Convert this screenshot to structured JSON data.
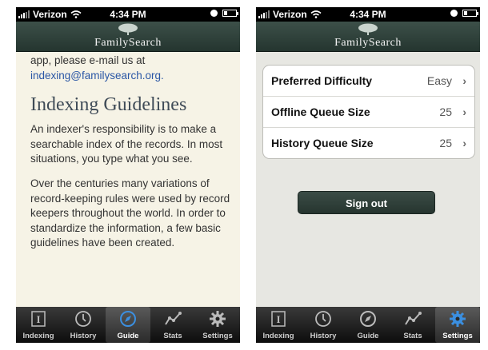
{
  "status": {
    "carrier": "Verizon",
    "time": "4:34 PM"
  },
  "brand": "FamilySearch",
  "guide": {
    "intro_text": "app, please e-mail us at",
    "email": "indexing@familysearch.org.",
    "heading": "Indexing Guidelines",
    "para1": "An indexer's responsibility is to make a searchable index of the records. In most situations, you type what you see.",
    "para2": "Over the centuries many variations of record-keeping rules were used by record keepers throughout the world. In order to standardize the information, a few basic guidelines have been created."
  },
  "settings": {
    "rows": [
      {
        "label": "Preferred Difficulty",
        "value": "Easy"
      },
      {
        "label": "Offline Queue Size",
        "value": "25"
      },
      {
        "label": "History Queue Size",
        "value": "25"
      }
    ],
    "signout_label": "Sign out"
  },
  "tabs": [
    {
      "label": "Indexing",
      "icon": "indexing-icon"
    },
    {
      "label": "History",
      "icon": "clock-icon"
    },
    {
      "label": "Guide",
      "icon": "compass-icon"
    },
    {
      "label": "Stats",
      "icon": "chart-icon"
    },
    {
      "label": "Settings",
      "icon": "gear-icon"
    }
  ],
  "colors": {
    "header": "#2f413a",
    "guide_bg": "#f6f3e6",
    "settings_bg": "#e7e7e2",
    "link": "#2a56a5",
    "active_tab_icon": "#3b8fe0"
  }
}
